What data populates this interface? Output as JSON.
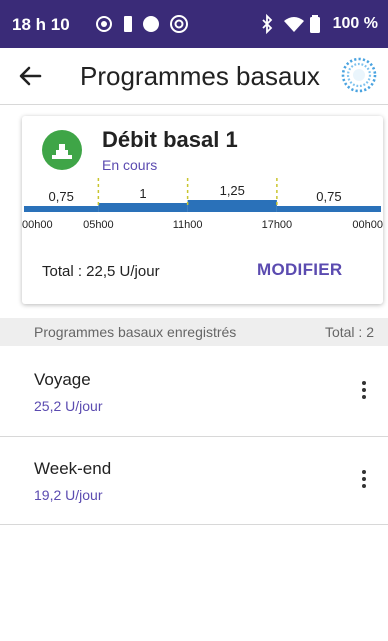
{
  "status_bar": {
    "time": "18 h 10",
    "battery": "100 %",
    "icons": [
      "nfc-icon",
      "sim-icon",
      "circle-icon",
      "do-not-disturb-icon",
      "bluetooth-icon",
      "wifi-icon",
      "battery-icon"
    ]
  },
  "header": {
    "title": "Programmes basaux",
    "back_icon": "arrow-left-icon",
    "pod_icon": "pod-status-icon"
  },
  "active_program": {
    "name": "Débit basal 1",
    "status": "En cours",
    "status_color": "#3fa547",
    "segments": [
      {
        "start": 0,
        "end": 5,
        "rate": "0,75"
      },
      {
        "start": 5,
        "end": 11,
        "rate": "1"
      },
      {
        "start": 11,
        "end": 17,
        "rate": "1,25"
      },
      {
        "start": 17,
        "end": 24,
        "rate": "0,75"
      }
    ],
    "time_labels": [
      "00h00",
      "05h00",
      "11h00",
      "17h00",
      "00h00"
    ],
    "total": "Total : 22,5 U/jour",
    "edit_label": "MODIFIER"
  },
  "saved_section": {
    "title": "Programmes basaux enregistrés",
    "count": "Total : 2"
  },
  "saved_programs": [
    {
      "name": "Voyage",
      "rate": "25,2 U/jour"
    },
    {
      "name": "Week-end",
      "rate": "19,2 U/jour"
    }
  ],
  "colors": {
    "status_bar": "#3a2b78",
    "accent": "#5b4bb0",
    "bar_blue": "#2a71b9",
    "active_green": "#3fa547",
    "divider_yellow": "#c9c52e"
  }
}
